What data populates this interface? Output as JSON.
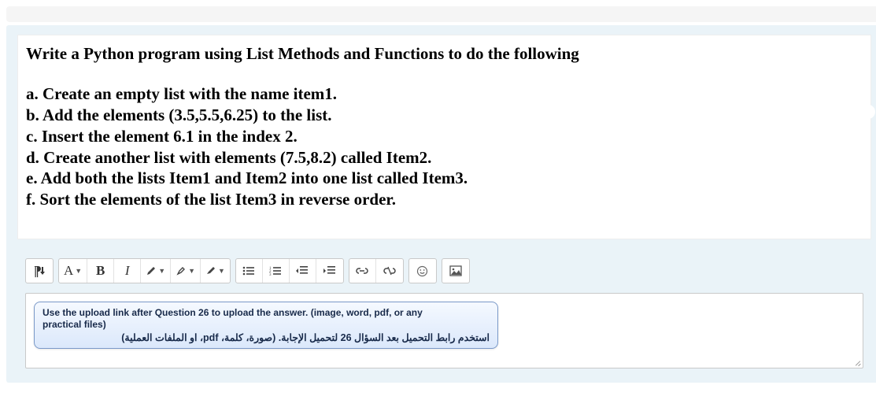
{
  "question": {
    "title": "Write a Python program using List Methods and Functions to do the following",
    "items": {
      "a": "a. Create an empty list with the name item1.",
      "b": "b. Add the elements (3.5,5.5,6.25) to the list.",
      "c": "c. Insert the element 6.1 in the index 2.",
      "d": "d. Create another list with elements (7.5,8.2) called Item2.",
      "e": "e. Add both the lists Item1 and Item2 into one list called Item3.",
      "f": "f. Sort the elements of the list Item3 in reverse order."
    }
  },
  "toolbar": {
    "paragraph_dir": "¶",
    "font_label": "A",
    "bold": "B",
    "italic": "I"
  },
  "notice": {
    "en": "Use the upload link after Question 26 to upload the answer. (image, word, pdf, or any practical files)",
    "ar": "استخدم رابط التحميل بعد السؤال 26 لتحميل الإجابة. (صورة، كلمة، pdf، او الملفات العملية)"
  }
}
